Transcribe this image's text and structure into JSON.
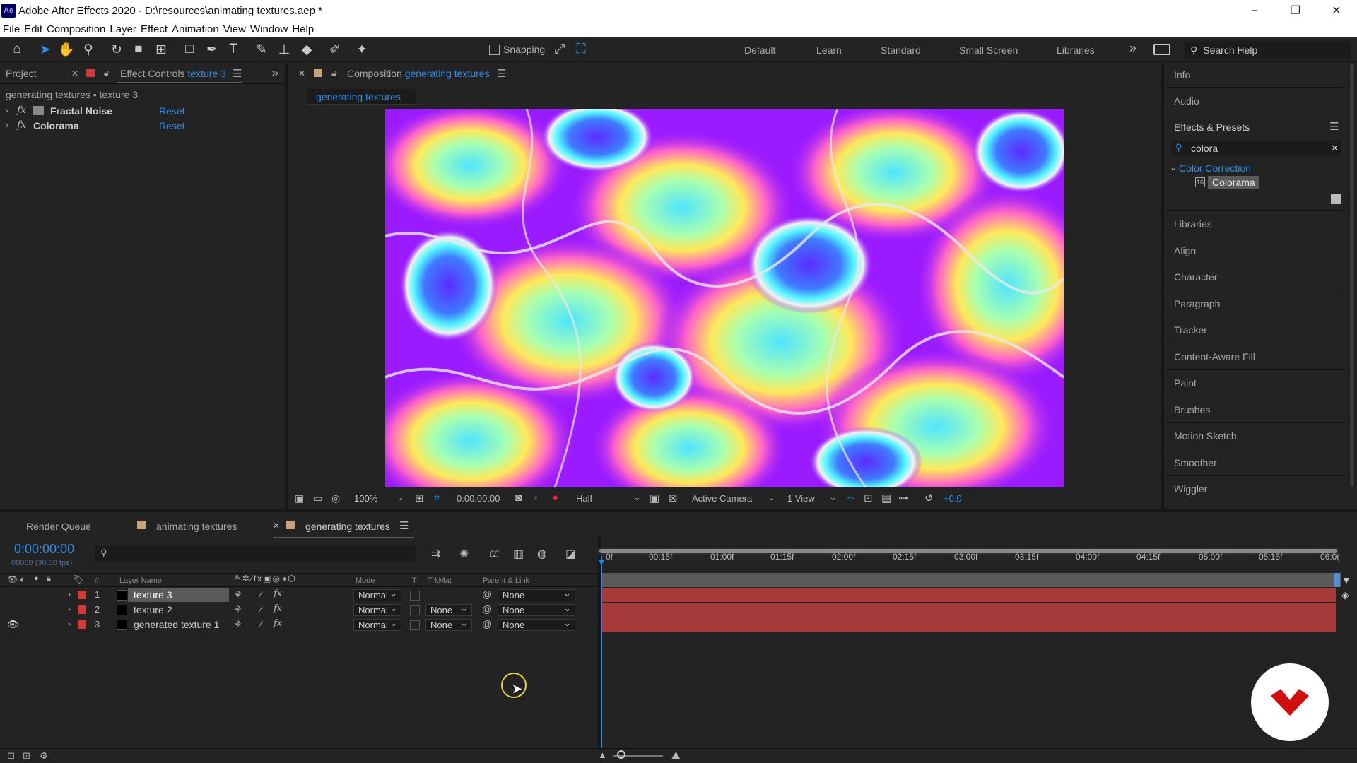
{
  "window": {
    "app_icon": "Ae",
    "title": "Adobe After Effects 2020 - D:\\resources\\animating textures.aep *",
    "controls": [
      "–",
      "❐",
      "✕"
    ]
  },
  "menu": [
    "File",
    "Edit",
    "Composition",
    "Layer",
    "Effect",
    "Animation",
    "View",
    "Window",
    "Help"
  ],
  "toolbar": {
    "snapping_label": "Snapping",
    "workspaces": [
      "Default",
      "Learn",
      "Standard",
      "Small Screen",
      "Libraries"
    ],
    "search_placeholder": "Search Help"
  },
  "left_panel": {
    "tab_project": "Project",
    "tab_effect_controls": "Effect Controls",
    "tab_effect_controls_layer": "texture 3",
    "breadcrumb": "generating textures • texture 3",
    "effects": [
      {
        "name": "Fractal Noise",
        "reset": "Reset"
      },
      {
        "name": "Colorama",
        "reset": "Reset"
      }
    ]
  },
  "composition_panel": {
    "tab_label": "Composition",
    "tab_comp_name": "generating textures",
    "subtab": "generating textures",
    "viewer_controls": {
      "zoom": "100%",
      "timecode": "0:00:00:00",
      "resolution": "Half",
      "camera": "Active Camera",
      "views": "1 View",
      "exposure": "+0.0"
    }
  },
  "right_panel": {
    "items_top": [
      "Info",
      "Audio"
    ],
    "effects_presets_title": "Effects & Presets",
    "search_value": "colora",
    "category": "Color Correction",
    "result": "Colorama",
    "items_bottom": [
      "Libraries",
      "Align",
      "Character",
      "Paragraph",
      "Tracker",
      "Content-Aware Fill",
      "Paint",
      "Brushes",
      "Motion Sketch",
      "Smoother",
      "Wiggler"
    ]
  },
  "timeline": {
    "tabs": [
      "Render Queue",
      "animating textures",
      "generating textures"
    ],
    "timecode": "0:00:00:00",
    "frame_info": "00000 (30.00 fps)",
    "columns": {
      "num": "#",
      "layer_name": "Layer Name",
      "mode": "Mode",
      "t": "T",
      "trkmat": "TrkMat",
      "parent": "Parent & Link"
    },
    "layers": [
      {
        "num": "1",
        "name": "texture 3",
        "mode": "Normal",
        "trkmat": "",
        "parent": "None"
      },
      {
        "num": "2",
        "name": "texture 2",
        "mode": "Normal",
        "trkmat": "None",
        "parent": "None"
      },
      {
        "num": "3",
        "name": "generated texture 1",
        "mode": "Normal",
        "trkmat": "None",
        "parent": "None"
      }
    ],
    "ruler_labels": [
      "0f",
      "00:15f",
      "01:00f",
      "01:15f",
      "02:00f",
      "02:15f",
      "03:00f",
      "03:15f",
      "04:00f",
      "04:15f",
      "05:00f",
      "05:15f",
      "06:0("
    ]
  },
  "colors": {
    "accent_blue": "#2d8ceb",
    "layer_bar": "#a63a3a",
    "label_red": "#d23a3a",
    "label_tan": "#c9a27e",
    "logo_red": "#d10f0f"
  }
}
